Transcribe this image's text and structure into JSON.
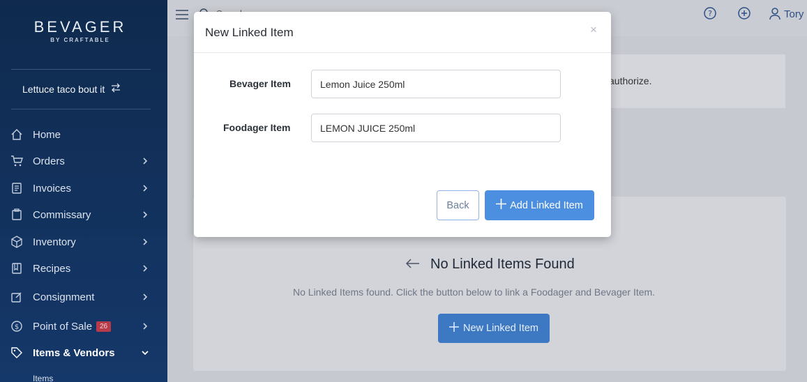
{
  "brand": {
    "name": "BEVAGER",
    "sub": "BY CRAFTABLE"
  },
  "location": {
    "name": "Lettuce taco bout it"
  },
  "nav": [
    {
      "label": "Home",
      "icon": "home-icon"
    },
    {
      "label": "Orders",
      "icon": "cart-icon"
    },
    {
      "label": "Invoices",
      "icon": "invoice-icon"
    },
    {
      "label": "Commissary",
      "icon": "clipboard-icon"
    },
    {
      "label": "Inventory",
      "icon": "box-icon"
    },
    {
      "label": "Recipes",
      "icon": "book-icon"
    },
    {
      "label": "Consignment",
      "icon": "edit-icon"
    },
    {
      "label": "Point of Sale",
      "icon": "dollar-icon",
      "badge": "26"
    },
    {
      "label": "Items & Vendors",
      "icon": "tag-icon"
    }
  ],
  "subnav": {
    "label": "Items"
  },
  "topbar": {
    "search_placeholder": "Search",
    "user": "Tory"
  },
  "alert": {
    "text": "authorize."
  },
  "empty": {
    "title": "No Linked Items Found",
    "description": "No Linked Items found. Click the button below to link a Foodager and Bevager Item.",
    "button": "New Linked Item"
  },
  "modal": {
    "title": "New Linked Item",
    "close": "×",
    "bevager_label": "Bevager Item",
    "bevager_value": "Lemon Juice 250ml",
    "foodager_label": "Foodager Item",
    "foodager_value": "LEMON JUICE 250ml",
    "back": "Back",
    "add": "Add Linked Item"
  },
  "colors": {
    "sidebar": "#0f2a4e",
    "primary": "#4c8fe0",
    "badge": "#b83b4a"
  }
}
